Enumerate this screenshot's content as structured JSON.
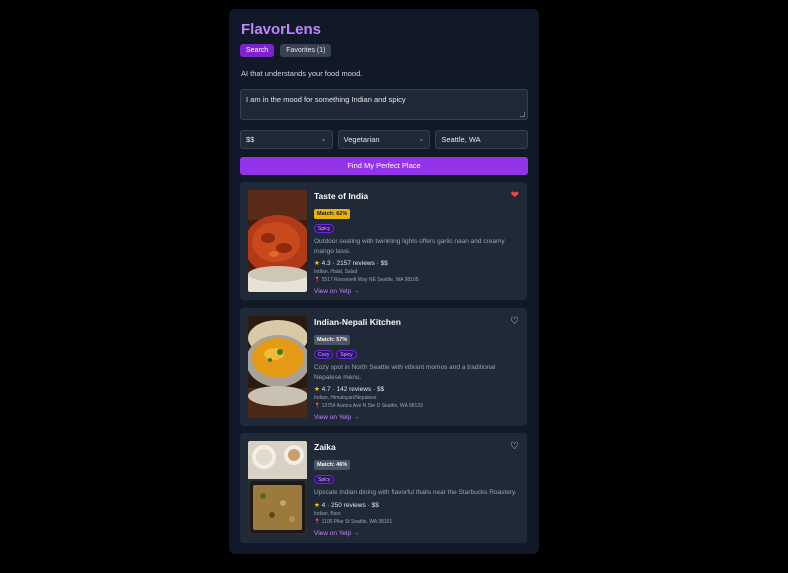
{
  "app": {
    "title": "FlavorLens",
    "tabs": [
      {
        "label": "Search"
      },
      {
        "label": "Favorites (1)"
      }
    ],
    "tagline": "AI that understands your food mood."
  },
  "search": {
    "query": "I am in the mood for something Indian and spicy",
    "price": "$$",
    "diet": "Vegetarian",
    "location": "Seattle, WA",
    "submit_label": "Find My Perfect Place"
  },
  "results": [
    {
      "name": "Taste of India",
      "match": "Match: 62%",
      "tags": [
        "Spicy"
      ],
      "description": "Outdoor seating with twinkling lights offers garlic naan and creamy mango lassi.",
      "rating": "4.3",
      "reviews": "2157 reviews",
      "price": "$$",
      "categories": "Indian, Halal, Salad",
      "address": "5517 Roosevelt Way NE Seattle, WA 98105",
      "link": "View on Yelp →",
      "favorite": true
    },
    {
      "name": "Indian-Nepali Kitchen",
      "match": "Match: 57%",
      "tags": [
        "Cozy",
        "Spicy"
      ],
      "description": "Cozy spot in North Seattle with vibrant momos and a traditional Nepalese menu.",
      "rating": "4.7",
      "reviews": "142 reviews",
      "price": "$$",
      "categories": "Indian, Himalayan/Nepalese",
      "address": "13754 Aurora Ave N Ste D Seattle, WA 98133",
      "link": "View on Yelp →",
      "favorite": false
    },
    {
      "name": "Zaika",
      "match": "Match: 46%",
      "tags": [
        "Spicy"
      ],
      "description": "Upscale Indian dining with flavorful thalis near the Starbucks Roastery.",
      "rating": "4",
      "reviews": "250 reviews",
      "price": "$$",
      "categories": "Indian, Bars",
      "address": "1100 Pike St Seattle, WA 98101",
      "link": "View on Yelp →",
      "favorite": false
    }
  ],
  "icons": {
    "star": "star-icon",
    "pin": "map-pin-icon",
    "heart_filled": "heart-filled-icon",
    "heart_outline": "heart-outline-icon",
    "chevron": "chevron-down-icon"
  },
  "colors": {
    "accent": "#9333ea",
    "title": "#c084fc",
    "match_high": "#eab308",
    "match_low": "#4b5563",
    "background": "#111827",
    "card": "#1f2937"
  }
}
